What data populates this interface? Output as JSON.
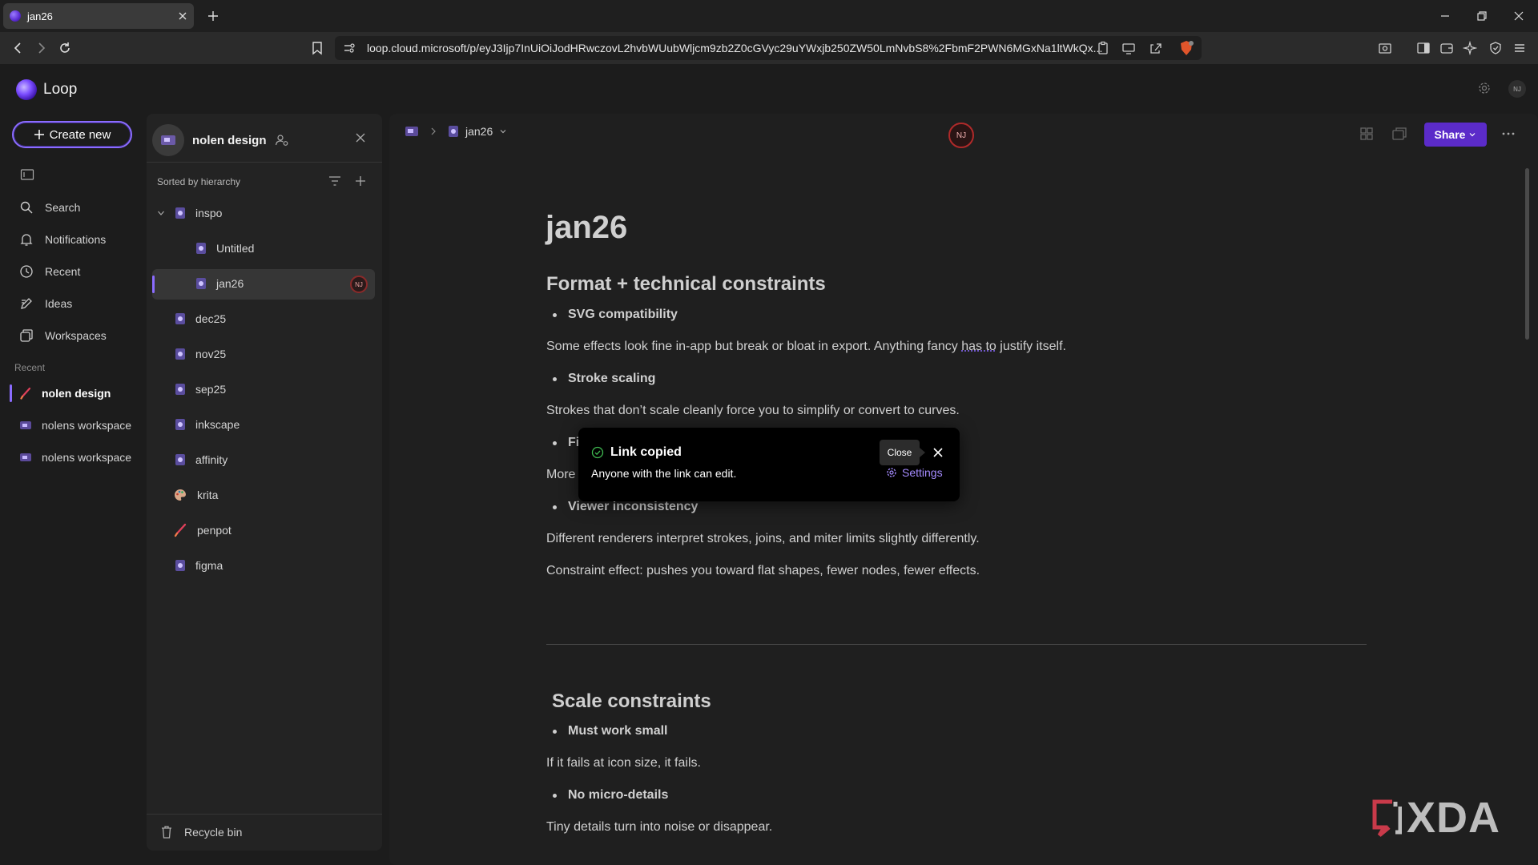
{
  "browser": {
    "tab_title": "jan26",
    "url": "loop.cloud.microsoft/p/eyJ3Ijp7InUiOiJodHRwczovL2hvbWUubWljcm9zb2Z0cGVyc29uYWxjb250ZW50LmNvbS8%2FbmF2PWN6MGxNa1ltWkQx..."
  },
  "app": {
    "name": "Loop",
    "user_initials": "NJ"
  },
  "leftnav": {
    "create_label": "Create new",
    "items": [
      "Search",
      "Notifications",
      "Recent",
      "Ideas",
      "Workspaces"
    ],
    "recent_label": "Recent",
    "recent_items": [
      "nolen design",
      "nolens workspace",
      "nolens workspace"
    ]
  },
  "workspace": {
    "name": "nolen design",
    "sorted_label": "Sorted by hierarchy",
    "tree": [
      "inspo",
      "Untitled",
      "jan26",
      "dec25",
      "nov25",
      "sep25",
      "inkscape",
      "affinity",
      "krita",
      "penpot",
      "figma"
    ],
    "recycle_label": "Recycle bin"
  },
  "doc": {
    "breadcrumb_page": "jan26",
    "share_label": "Share",
    "title": "jan26",
    "section1": "Format + technical constraints",
    "b1": "SVG compatibility",
    "p1a": "Some effects look fine in-app but break or bloat in export. Anything fancy ",
    "p1b": "has to",
    "p1c": " justify itself.",
    "b2": "Stroke scaling",
    "p2": "Strokes that don’t scale cleanly force you to simplify or convert to curves.",
    "b3": "Fi",
    "p3": "More",
    "b4": "Viewer inconsistency",
    "p4": "Different renderers interpret strokes, joins, and miter limits slightly differently.",
    "p5": "Constraint effect: pushes you toward flat shapes, fewer nodes, fewer effects.",
    "section2": "Scale constraints",
    "b5": "Must work small",
    "p6": "If it fails at icon size, it fails.",
    "b6": "No micro-details",
    "p7": "Tiny details turn into noise or disappear."
  },
  "toast": {
    "title": "Link copied",
    "body": "Anyone with the link can edit.",
    "close_tooltip": "Close",
    "settings_label": "Settings"
  },
  "watermark": {
    "text": "XDA"
  },
  "colors": {
    "accent": "#8b6cff",
    "share": "#5b2bc9",
    "avatar_ring": "#b02a2a"
  }
}
